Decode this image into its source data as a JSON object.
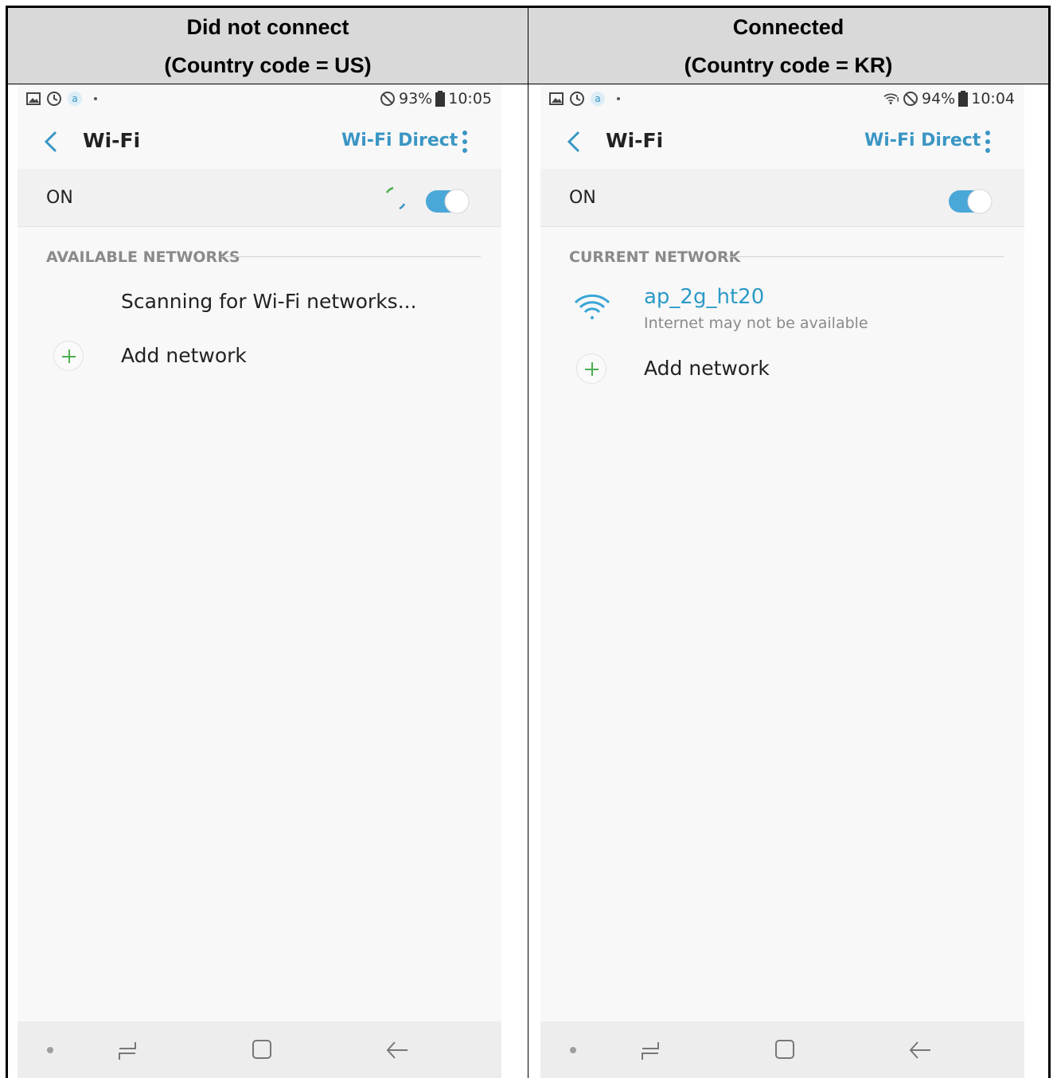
{
  "columns": [
    {
      "header_line1": "Did not connect",
      "header_line2": "(Country code = US)",
      "status": {
        "battery_pct": "93%",
        "time": "10:05"
      },
      "appbar": {
        "title": "Wi-Fi",
        "wifi_direct": "Wi-Fi Direct"
      },
      "toggle_row": {
        "label": "ON"
      },
      "section_title": "AVAILABLE NETWORKS",
      "scanning_text": "Scanning for Wi-Fi networks...",
      "add_network": "Add network"
    },
    {
      "header_line1": "Connected",
      "header_line2": "(Country code = KR)",
      "status": {
        "battery_pct": "94%",
        "time": "10:04"
      },
      "appbar": {
        "title": "Wi-Fi",
        "wifi_direct": "Wi-Fi Direct"
      },
      "toggle_row": {
        "label": "ON"
      },
      "section_title": "CURRENT NETWORK",
      "network": {
        "name": "ap_2g_ht20",
        "status": "Internet may not be available"
      },
      "add_network": "Add network"
    }
  ],
  "colors": {
    "accent": "#3a96c4",
    "toggle_on": "#4aa8d8",
    "plus": "#4caf50",
    "header_bg": "#d9d9d9"
  },
  "icons": [
    "gallery-icon",
    "sync-icon",
    "at-icon",
    "no-sim-icon",
    "battery-icon",
    "wifi-status-icon",
    "back-arrow-icon",
    "more-options-icon",
    "loading-spinner-icon",
    "add-icon",
    "wifi-signal-icon",
    "nav-recents-icon",
    "nav-home-icon",
    "nav-back-icon"
  ]
}
